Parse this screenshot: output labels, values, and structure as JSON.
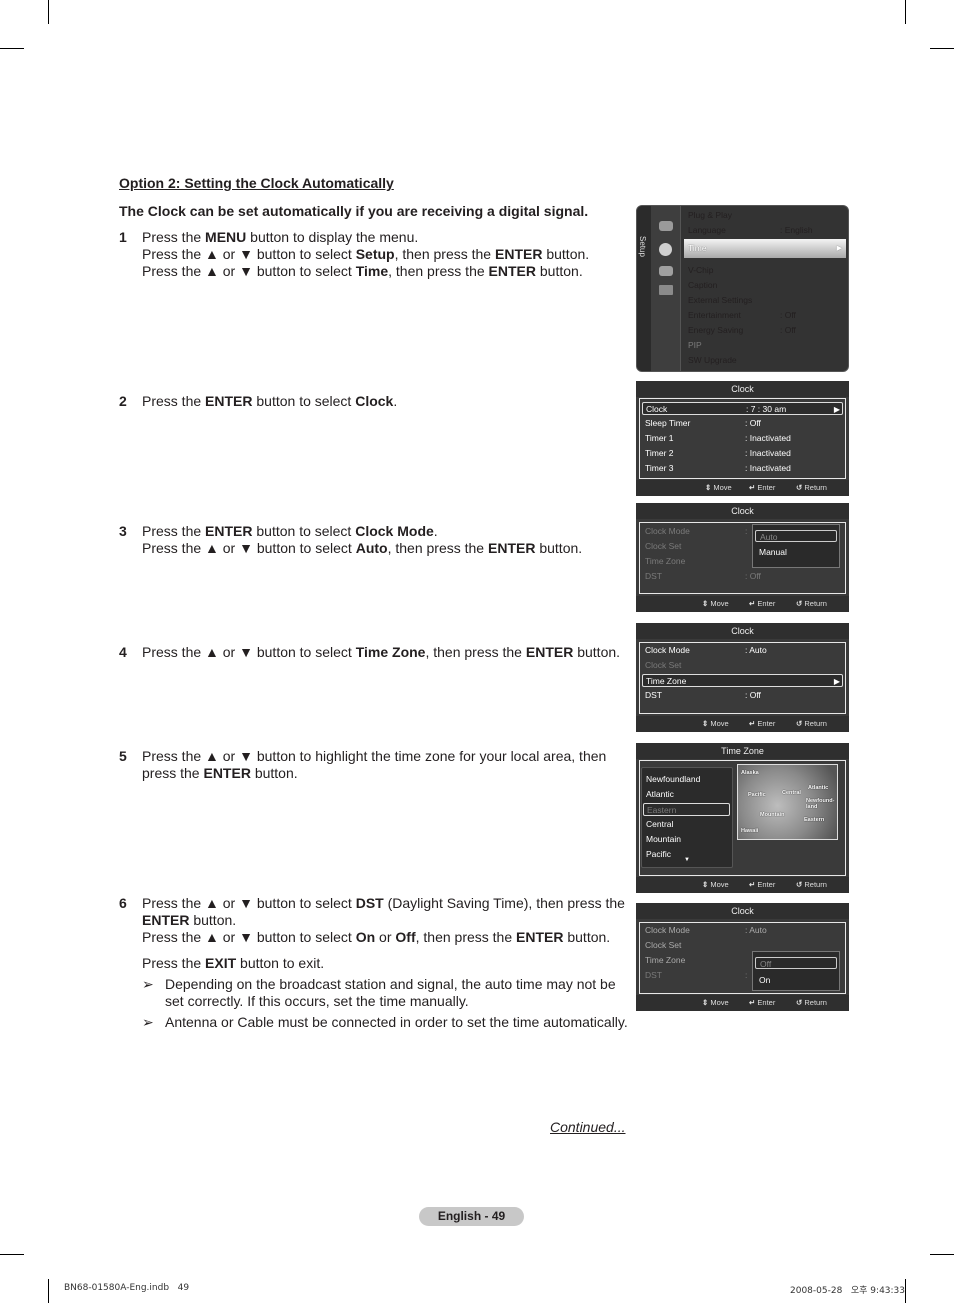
{
  "heading": "Option 2: Setting the Clock Automatically",
  "intro": "The Clock can be set automatically if you are receiving a digital signal.",
  "steps": {
    "s1": {
      "num": "1",
      "l1": [
        "Press the ",
        "MENU",
        " button to display the menu."
      ],
      "l2": [
        "Press the ▲ or ▼ button to select ",
        "Setup",
        ", then press the ",
        "ENTER",
        " button."
      ],
      "l3": [
        "Press the ▲ or ▼ button to select ",
        "Time",
        ", then press the ",
        "ENTER",
        " button."
      ]
    },
    "s2": {
      "num": "2",
      "l1": [
        "Press the ",
        "ENTER",
        " button to select ",
        "Clock",
        "."
      ]
    },
    "s3": {
      "num": "3",
      "l1": [
        "Press the ",
        "ENTER",
        " button to select ",
        "Clock Mode",
        "."
      ],
      "l2": [
        "Press the ▲ or ▼ button to select ",
        "Auto",
        ", then press the ",
        "ENTER",
        " button."
      ]
    },
    "s4": {
      "num": "4",
      "l1": [
        "Press the ▲ or ▼ button to select ",
        "Time Zone",
        ", then press the ",
        "ENTER",
        " button."
      ]
    },
    "s5": {
      "num": "5",
      "l1": [
        "Press the ▲ or ▼ button to highlight the time zone for your local area, then"
      ],
      "l2": [
        "press the ",
        "ENTER",
        " button."
      ]
    },
    "s6": {
      "num": "6",
      "l1": [
        "Press the ▲ or ▼ button to select ",
        "DST",
        " (Daylight Saving Time), then press the"
      ],
      "l2": [
        "ENTER",
        " button."
      ],
      "l3": [
        "Press the ▲ or ▼ button to select ",
        "On",
        " or ",
        "Off",
        ", then press the ",
        "ENTER",
        " button."
      ],
      "l4": [
        "Press the ",
        "EXIT",
        " button to exit."
      ],
      "note1": "Depending on the broadcast station and signal, the auto time may not be set correctly. If this occurs, set the time manually.",
      "note2": "Antenna or Cable must be connected in order to set the time automatically.",
      "note_arrow": "➢"
    }
  },
  "continued": "Continued...",
  "page_label": "English - 49",
  "footer": {
    "file": "BN68-01580A-Eng.indb   49",
    "timestamp": "2008-05-28   오후 9:43:33"
  },
  "osd_common": {
    "move": "Move",
    "enter": "Enter",
    "return": "Return",
    "move_icon": "⇕",
    "enter_icon": "↵",
    "return_icon": "↺",
    "arrow_right": "▶",
    "arrow_down": "▼"
  },
  "setup_menu": {
    "tab": "Setup",
    "items": [
      {
        "label": "Plug & Play",
        "value": ""
      },
      {
        "label": "Language",
        "value": ": English"
      },
      {
        "label": "Time",
        "value": "",
        "selected": true
      },
      {
        "label": "V-Chip",
        "value": ""
      },
      {
        "label": "Caption",
        "value": ""
      },
      {
        "label": "External Settings",
        "value": ""
      },
      {
        "label": "Entertainment",
        "value": ": Off"
      },
      {
        "label": "Energy Saving",
        "value": ": Off"
      },
      {
        "label": "PIP",
        "value": "",
        "disabled": true
      },
      {
        "label": "SW Upgrade",
        "value": ""
      }
    ]
  },
  "clock_menu": {
    "title": "Clock",
    "rows": [
      {
        "label": "Clock",
        "value": ": 7 : 30 am",
        "selected": true
      },
      {
        "label": "Sleep Timer",
        "value": ": Off"
      },
      {
        "label": "Timer 1",
        "value": ": Inactivated"
      },
      {
        "label": "Timer 2",
        "value": ": Inactivated"
      },
      {
        "label": "Timer 3",
        "value": ": Inactivated"
      }
    ]
  },
  "clock_mode_menu": {
    "title": "Clock",
    "rows": [
      {
        "label": "Clock Mode",
        "value": ":"
      },
      {
        "label": "Clock Set",
        "value": ""
      },
      {
        "label": "Time Zone",
        "value": ""
      },
      {
        "label": "DST",
        "value": ": Off"
      }
    ],
    "options": [
      "Auto",
      "Manual"
    ],
    "selected_option": "Auto"
  },
  "timezone_select_menu": {
    "title": "Clock",
    "rows": [
      {
        "label": "Clock Mode",
        "value": ": Auto"
      },
      {
        "label": "Clock Set",
        "value": "",
        "disabled": true
      },
      {
        "label": "Time Zone",
        "value": "",
        "selected": true
      },
      {
        "label": "DST",
        "value": ": Off"
      }
    ]
  },
  "timezone_menu": {
    "title": "Time Zone",
    "zones": [
      "Newfoundland",
      "Atlantic",
      "Eastern",
      "Central",
      "Mountain",
      "Pacific"
    ],
    "selected": "Eastern",
    "map_labels": [
      "Alaska",
      "Pacific",
      "Central",
      "Atlantic",
      "Newfound-land",
      "Mountain",
      "Eastern",
      "Hawaii"
    ]
  },
  "dst_menu": {
    "title": "Clock",
    "rows": [
      {
        "label": "Clock Mode",
        "value": ": Auto"
      },
      {
        "label": "Clock Set",
        "value": ""
      },
      {
        "label": "Time Zone",
        "value": ""
      },
      {
        "label": "DST",
        "value": ":"
      }
    ],
    "options": [
      "Off",
      "On"
    ],
    "selected_option": "Off"
  }
}
